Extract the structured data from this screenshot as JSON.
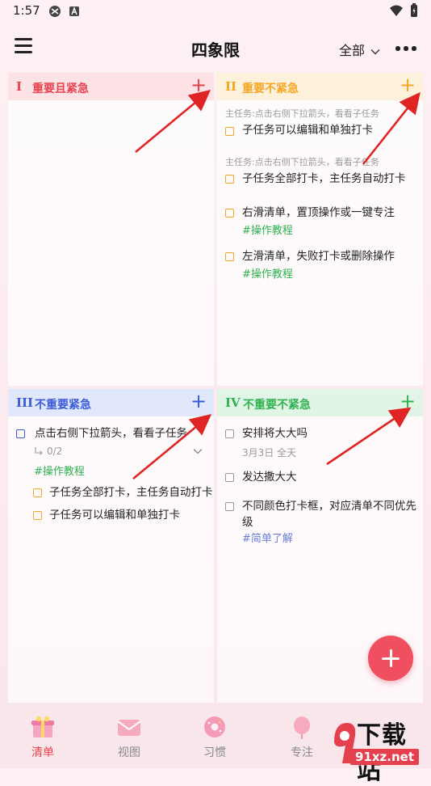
{
  "status_bar": {
    "time": "1:57"
  },
  "header": {
    "title": "四象限",
    "filter_label": "全部"
  },
  "quadrants": [
    {
      "numeral": "I",
      "title": "重要且紧急",
      "accent": "#e9424f",
      "head_bg": "#fde3e6"
    },
    {
      "numeral": "II",
      "title": "重要不紧急",
      "accent": "#f5a623",
      "head_bg": "#fdf1dc",
      "hint1": "主任务:点击右侧下拉箭头，看看子任务",
      "task1": "子任务可以编辑和单独打卡",
      "hint2": "主任务:点击右侧下拉箭头，看看子任务",
      "task2": "子任务全部打卡，主任务自动打卡",
      "task3": "右滑清单，置顶操作或一键专注",
      "task3_tag": "#操作教程",
      "task4": "左滑清单，失败打卡或删除操作",
      "task4_tag": "#操作教程"
    },
    {
      "numeral": "III",
      "title": "不重要紧急",
      "accent": "#3b5bdb",
      "head_bg": "#e2e8fb",
      "task1": "点击右侧下拉箭头，看看子任务",
      "progress": "0/2",
      "task1_tag": "#操作教程",
      "sub1": "子任务全部打卡，主任务自动打卡",
      "sub2": "子任务可以编辑和单独打卡"
    },
    {
      "numeral": "IV",
      "title": "不重要不紧急",
      "accent": "#2fb24f",
      "head_bg": "#e0f5e6",
      "task1": "安排将大大吗",
      "task1_meta": "3月3日 全天",
      "task2": "发达撒大大",
      "task3_line1": "不同颜色打卡框，对应清单不同优先",
      "task3_line2": "级",
      "task3_tag": "#简单了解"
    }
  ],
  "bottom_nav": [
    {
      "label": "清单",
      "active": true
    },
    {
      "label": "视图",
      "active": false
    },
    {
      "label": "习惯",
      "active": false
    },
    {
      "label": "专注",
      "active": false
    }
  ],
  "watermark": {
    "text": "下载站",
    "url_text": "91xz.net"
  },
  "colors": {
    "red": "#e9424f",
    "orange": "#f5a623",
    "blue": "#3b5bdb",
    "green": "#2fb24f",
    "fab": "#ef4f5f"
  }
}
